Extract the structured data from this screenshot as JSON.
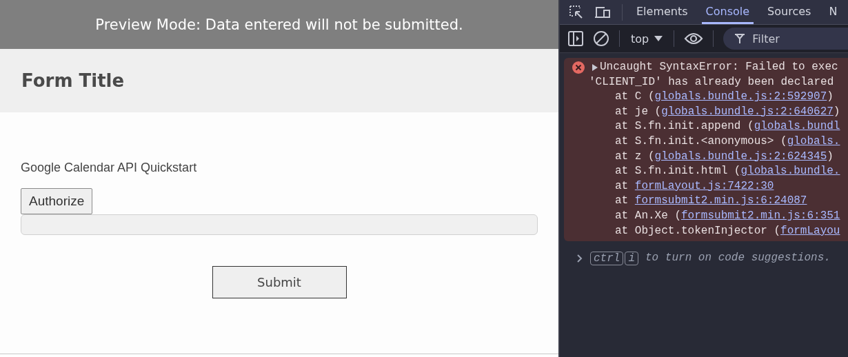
{
  "preview_banner": {
    "text": "Preview Mode: Data entered will not be submitted."
  },
  "form": {
    "title": "Form Title",
    "label": "Google Calendar API Quickstart",
    "authorize_button": "Authorize",
    "submit_button": "Submit"
  },
  "devtools": {
    "tabs": [
      {
        "label": "Elements",
        "selected": false
      },
      {
        "label": "Console",
        "selected": true
      },
      {
        "label": "Sources",
        "selected": false
      },
      {
        "label": "N",
        "selected": false
      }
    ],
    "context": "top",
    "filter_placeholder": "Filter",
    "error": {
      "message": "Uncaught SyntaxError: Failed to exec",
      "detail": "'CLIENT_ID' has already been declared",
      "stack": [
        {
          "before": "at C (",
          "link": "globals.bundle.js:2:592907",
          "after": ")"
        },
        {
          "before": "at je (",
          "link": "globals.bundle.js:2:640627",
          "after": ")"
        },
        {
          "before": "at S.fn.init.append (",
          "link": "globals.bundl"
        },
        {
          "before": "at S.fn.init.<anonymous> (",
          "link": "globals."
        },
        {
          "before": "at z (",
          "link": "globals.bundle.js:2:624345",
          "after": ")"
        },
        {
          "before": "at S.fn.init.html (",
          "link": "globals.bundle."
        },
        {
          "before": "at ",
          "link": "formLayout.js:7422:30"
        },
        {
          "before": "at ",
          "link": "formsubmit2.min.js:6:24087"
        },
        {
          "before": "at An.Xe (",
          "link": "formsubmit2.min.js:6:351"
        },
        {
          "before": "at Object.tokenInjector (",
          "link": "formLayou"
        }
      ]
    },
    "prompt": {
      "keys": [
        "ctrl",
        "i"
      ],
      "hint": "to turn on code suggestions."
    }
  }
}
